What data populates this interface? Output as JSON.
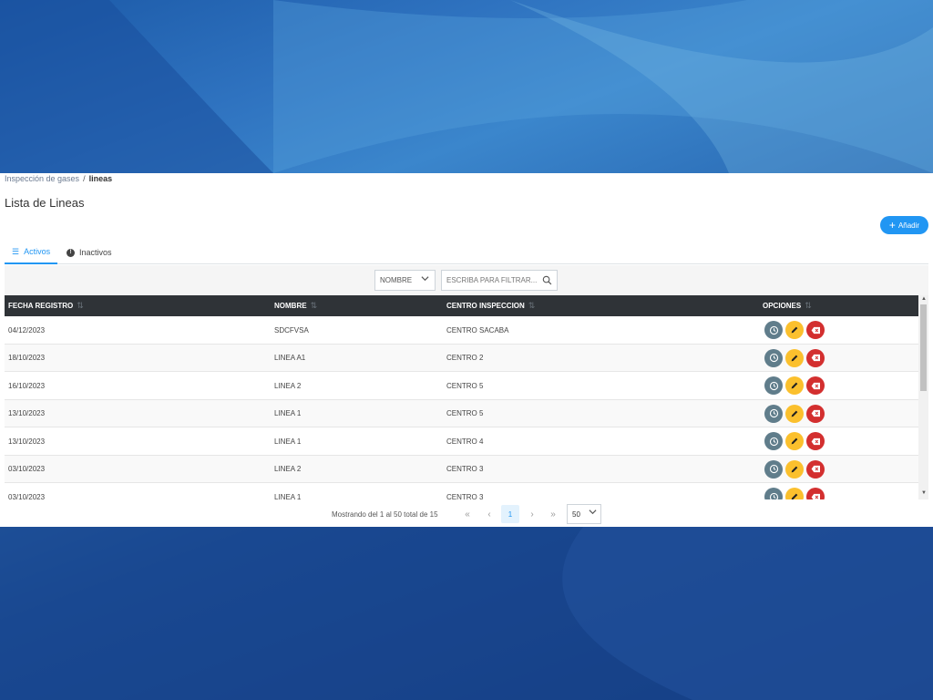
{
  "breadcrumb": {
    "parent": "Inspección de gases",
    "separator": "/",
    "current": "lineas"
  },
  "page_title": "Lista de Lineas",
  "add_button": {
    "label": "Añadir",
    "color": "#2196f3"
  },
  "tabs": [
    {
      "label": "Activos",
      "icon": "list-icon",
      "active": true
    },
    {
      "label": "Inactivos",
      "icon": "info-icon",
      "active": false
    }
  ],
  "filter": {
    "field_selected": "NOMBRE",
    "input_placeholder": "ESCRIBA PARA FILTRAR..."
  },
  "table": {
    "columns": [
      "FECHA REGISTRO",
      "NOMBRE",
      "CENTRO INSPECCION",
      "OPCIONES"
    ],
    "rows": [
      {
        "fecha": "04/12/2023",
        "nombre": "SDCFVSA",
        "centro": "CENTRO SACABA"
      },
      {
        "fecha": "18/10/2023",
        "nombre": "LINEA A1",
        "centro": "CENTRO 2"
      },
      {
        "fecha": "16/10/2023",
        "nombre": "LINEA 2",
        "centro": "CENTRO 5"
      },
      {
        "fecha": "13/10/2023",
        "nombre": "LINEA 1",
        "centro": "CENTRO 5"
      },
      {
        "fecha": "13/10/2023",
        "nombre": "LINEA 1",
        "centro": "CENTRO 4"
      },
      {
        "fecha": "03/10/2023",
        "nombre": "LINEA 2",
        "centro": "CENTRO 3"
      },
      {
        "fecha": "03/10/2023",
        "nombre": "LINEA 1",
        "centro": "CENTRO 3"
      }
    ],
    "action_colors": {
      "history": "#607d8b",
      "edit": "#fbc02d",
      "delete": "#d32f2f"
    }
  },
  "pagination": {
    "summary": "Mostrando del 1 al 50 total de 15",
    "current_page": "1",
    "page_size": "50"
  }
}
